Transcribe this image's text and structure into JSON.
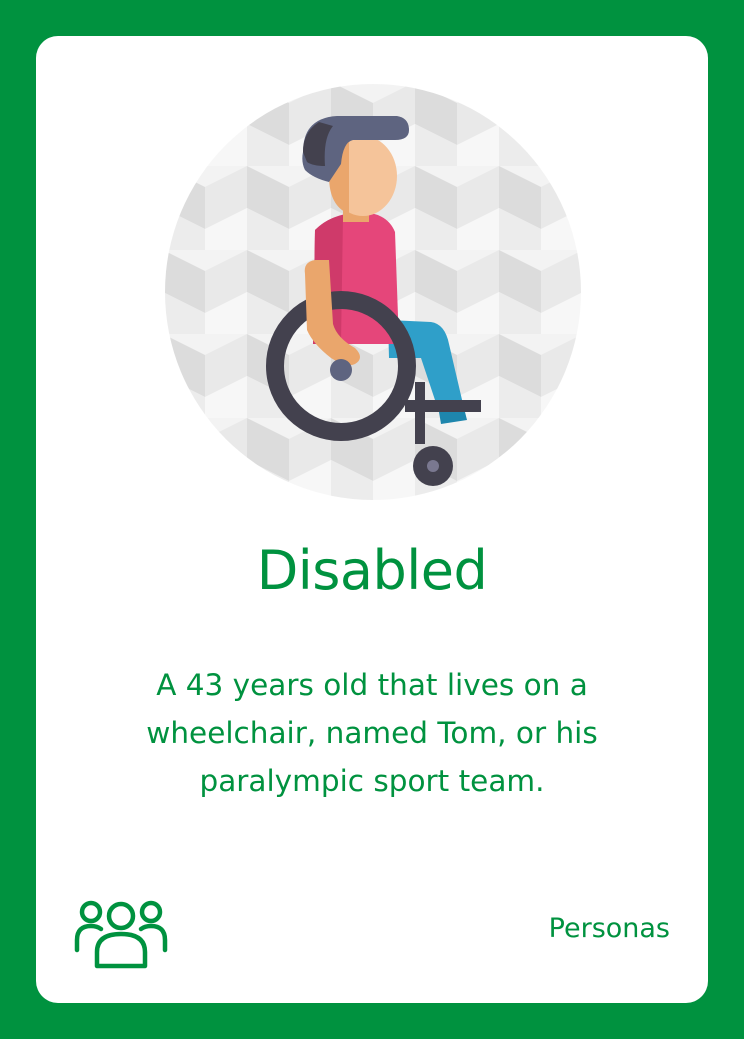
{
  "card": {
    "title": "Disabled",
    "description": "A 43 years old that lives on a wheelchair, named Tom, or his paralympic sport team.",
    "category": "Personas",
    "illustration_icon": "person-in-wheelchair-icon",
    "category_icon": "group-of-people-icon"
  },
  "colors": {
    "border": "#00923f",
    "card_background": "#ffffff",
    "text": "#00923f",
    "hair": "#5e6480",
    "skin": "#f5c49a",
    "shirt": "#e5467a",
    "pants": "#2f9fc9",
    "wheel": "#43414e"
  }
}
